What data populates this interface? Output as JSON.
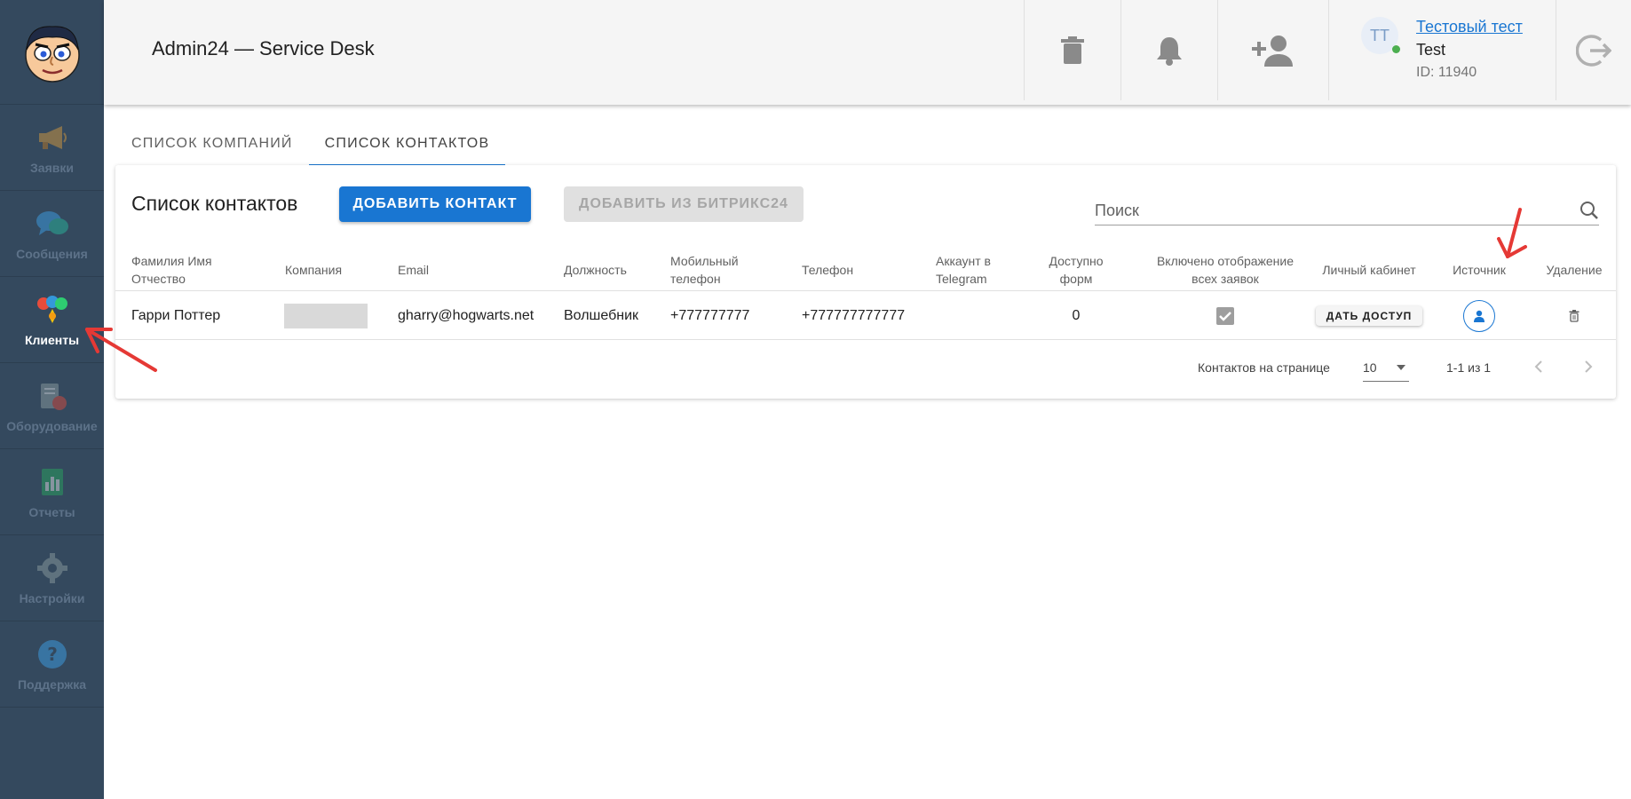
{
  "sidebar": {
    "items": [
      {
        "label": "Заявки",
        "icon": "megaphone-icon"
      },
      {
        "label": "Сообщения",
        "icon": "chat-icon"
      },
      {
        "label": "Клиенты",
        "icon": "clients-icon",
        "active": true
      },
      {
        "label": "Оборудование",
        "icon": "equipment-icon"
      },
      {
        "label": "Отчеты",
        "icon": "report-icon"
      },
      {
        "label": "Настройки",
        "icon": "gear-icon"
      },
      {
        "label": "Поддержка",
        "icon": "help-icon"
      }
    ]
  },
  "header": {
    "title": "Admin24 — Service Desk",
    "user": {
      "initials": "TT",
      "name": "Тестовый тест",
      "login": "Test",
      "id_text": "ID: 11940"
    }
  },
  "tabs": [
    {
      "label": "СПИСОК КОМПАНИЙ",
      "active": false
    },
    {
      "label": "СПИСОК КОНТАКТОВ",
      "active": true
    }
  ],
  "card": {
    "title": "Список контактов",
    "add_button": "ДОБАВИТЬ КОНТАКТ",
    "bitrix_button": "ДОБАВИТЬ ИЗ БИТРИКС24",
    "search_placeholder": "Поиск"
  },
  "table": {
    "columns": [
      "Фамилия Имя Отчество",
      "Компания",
      "Email",
      "Должность",
      "Мобильный телефон",
      "Телефон",
      "Аккаунт в Telegram",
      "Доступно форм",
      "Включено отображение всех заявок",
      "Личный кабинет",
      "Источник",
      "Удаление"
    ],
    "rows": [
      {
        "name": "Гарри Поттер",
        "company": "",
        "email": "gharry@hogwarts.net",
        "position": "Волшебник",
        "mobile": "+777777777",
        "phone": "+777777777777",
        "telegram": "",
        "forms": "0",
        "show_all": true,
        "cabinet_button": "ДАТЬ ДОСТУП"
      }
    ]
  },
  "footer": {
    "per_page_label": "Контактов на странице",
    "per_page_value": "10",
    "range": "1-1 из 1"
  },
  "colors": {
    "accent": "#1976d2",
    "sidebar": "#34495e",
    "annotation": "#e53935"
  }
}
